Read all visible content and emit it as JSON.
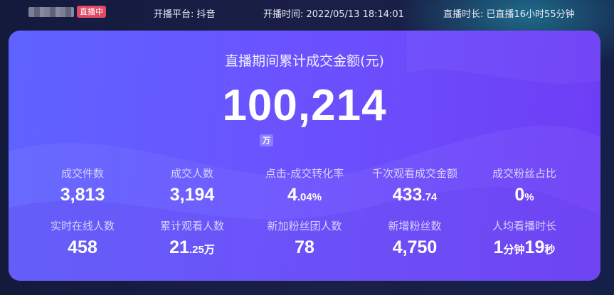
{
  "header": {
    "live_badge": "直播中",
    "platform": "开播平台: 抖音",
    "start_time": "开播时间: 2022/05/13 18:14:01",
    "duration": "直播时长: 已直播16小时55分钟"
  },
  "summary": {
    "title": "直播期间累计成交金额(元)",
    "total": "100,214",
    "unit": "万"
  },
  "metrics": [
    {
      "label": "成交件数",
      "value_main": "3,813",
      "value_suffix": ""
    },
    {
      "label": "成交人数",
      "value_main": "3,194",
      "value_suffix": ""
    },
    {
      "label": "点击-成交转化率",
      "value_main": "4",
      "value_suffix": ".04%"
    },
    {
      "label": "千次观看成交金额",
      "value_main": "433",
      "value_suffix": ".74"
    },
    {
      "label": "成交粉丝占比",
      "value_main": "0",
      "value_suffix": "%"
    },
    {
      "label": "实时在线人数",
      "value_main": "458",
      "value_suffix": ""
    },
    {
      "label": "累计观看人数",
      "value_main": "21",
      "value_suffix": ".25万"
    },
    {
      "label": "新加粉丝团人数",
      "value_main": "78",
      "value_suffix": ""
    },
    {
      "label": "新增粉丝数",
      "value_main": "4,750",
      "value_suffix": ""
    },
    {
      "label": "人均看播时长",
      "value_main": "1",
      "value_suffix": "分钟",
      "value_main2": "19",
      "value_suffix2": "秒"
    }
  ]
}
